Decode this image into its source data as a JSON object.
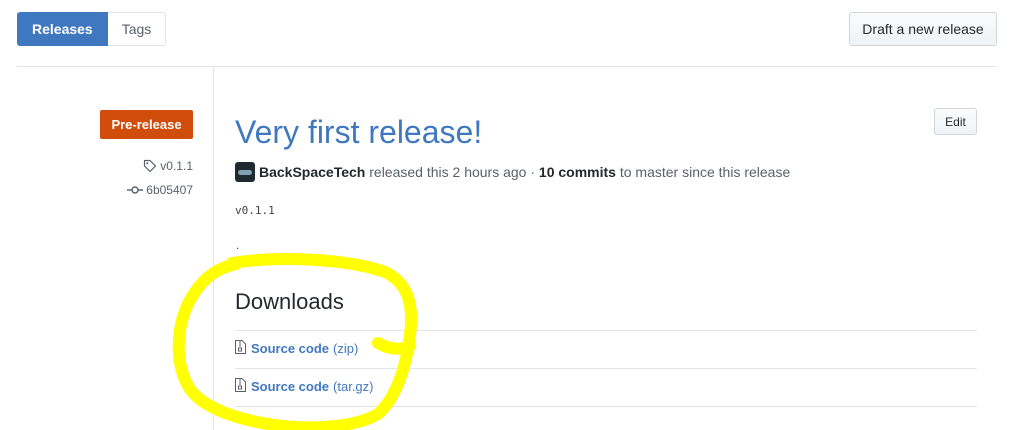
{
  "tabs": [
    {
      "label": "Releases",
      "selected": true
    },
    {
      "label": "Tags",
      "selected": false
    }
  ],
  "draft_button": "Draft a new release",
  "release": {
    "badge": "Pre-release",
    "tag": "v0.1.1",
    "commit": "6b05407",
    "title": "Very first release!",
    "edit_label": "Edit",
    "author": "BackSpaceTech",
    "released_text": " released this 2 hours ago · ",
    "commits_count": "10 commits",
    "commits_suffix": " to master since this release",
    "body_tag": "v0.1.1",
    "body_dot": "."
  },
  "downloads": {
    "heading": "Downloads",
    "items": [
      {
        "name": "Source code",
        "ext": "(zip)"
      },
      {
        "name": "Source code",
        "ext": "(tar.gz)"
      }
    ]
  },
  "colors": {
    "accent": "#4078c0",
    "prerelease": "#d04d0b",
    "highlight": "#ffff00"
  }
}
